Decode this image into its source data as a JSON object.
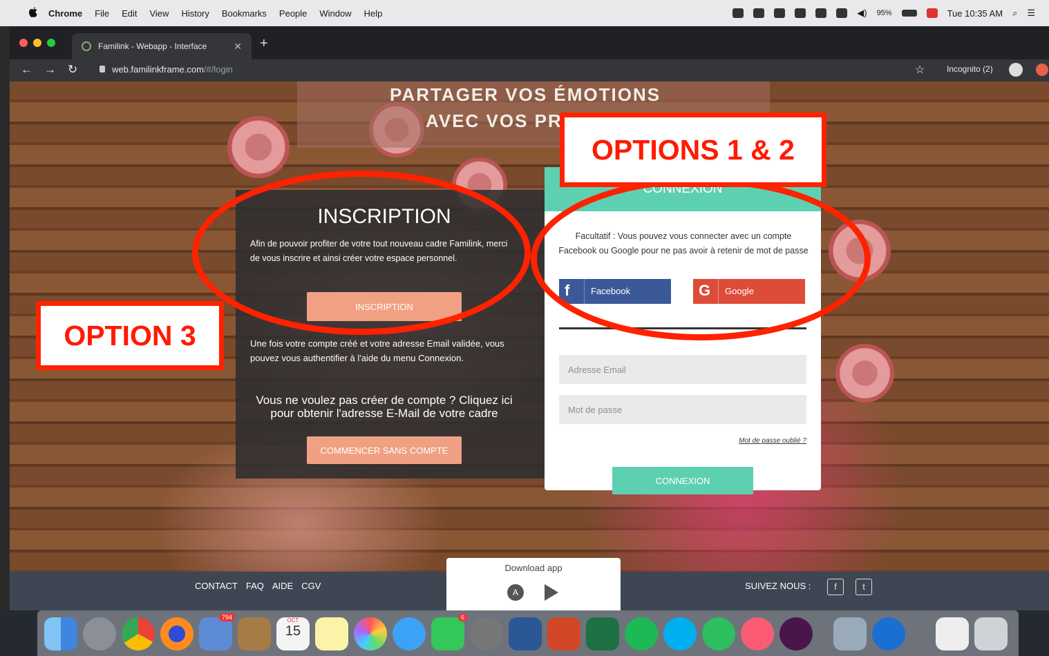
{
  "menubar": {
    "app_name": "Chrome",
    "items": [
      "File",
      "Edit",
      "View",
      "History",
      "Bookmarks",
      "People",
      "Window",
      "Help"
    ],
    "battery": "95%",
    "clock": "Tue 10:35 AM"
  },
  "browser": {
    "tab_title": "Familink - Webapp - Interface",
    "url_host": "web.familinkframe.com",
    "url_path": "/#/login",
    "profile_label": "Incognito (2)"
  },
  "page": {
    "heading_line1": "PARTAGER VOS ÉMOTIONS",
    "heading_line2": "AVEC VOS PR",
    "inscription": {
      "title": "INSCRIPTION",
      "description": "Afin de pouvoir profiter de votre tout nouveau cadre Familink, merci de vous inscrire et ainsi créer votre espace personnel.",
      "button_label": "INSCRIPTION",
      "after_text": "Une fois votre compte créé et votre adresse Email validée, vous pouvez vous authentifier à l'aide du menu Connexion.",
      "no_account_text": "Vous ne voulez pas créer de compte ? Cliquez ici pour obtenir l'adresse E-Mail de votre cadre",
      "no_account_button": "COMMENCER SANS COMPTE"
    },
    "connexion": {
      "header": "CONNEXION",
      "optional_text": "Facultatif : Vous pouvez vous connecter avec un compte Facebook ou Google pour ne pas avoir à retenir de mot de passe",
      "facebook_label": "Facebook",
      "google_label": "Google",
      "email_placeholder": "Adresse Email",
      "password_placeholder": "Mot de passe",
      "forgot_label": "Mot de passe oublié ?",
      "submit_label": "CONNEXION"
    }
  },
  "footer": {
    "links": [
      "CONTACT",
      "FAQ",
      "AIDE",
      "CGV"
    ],
    "follow_label": "SUIVEZ NOUS :",
    "download_label": "Download app"
  },
  "dock": {
    "calendar_month": "OCT",
    "calendar_day": "15",
    "mail_badge": "794",
    "facetime_badge": "6"
  },
  "annotations": {
    "options_1_2": "OPTIONS 1 & 2",
    "option_3": "OPTION 3",
    "color": "#ff2200"
  }
}
